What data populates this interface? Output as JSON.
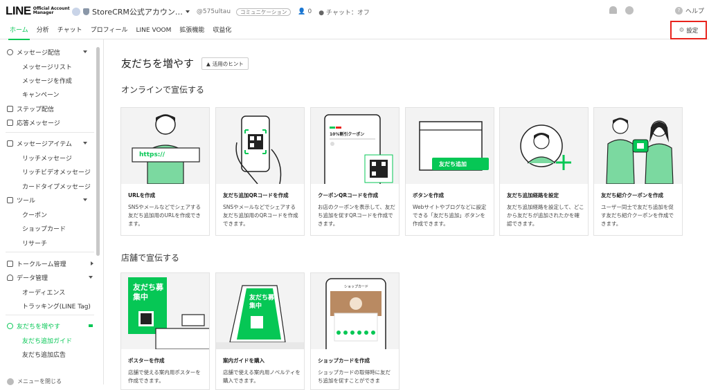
{
  "header": {
    "logo_main": "LINE",
    "logo_sub1": "Official Account",
    "logo_sub2": "Manager",
    "account_name": "StoreCRM公式アカウン…",
    "account_id": "@575ultau",
    "plan": "コミュニケーション",
    "friends_count": "0",
    "chat_status": "チャット：オフ",
    "help": "ヘルプ"
  },
  "nav": {
    "tabs": [
      "ホーム",
      "分析",
      "チャット",
      "プロフィール",
      "LINE VOOM",
      "拡張機能",
      "収益化"
    ],
    "settings": "設定"
  },
  "sidebar": {
    "message": "メッセージ配信",
    "message_list": "メッセージリスト",
    "message_create": "メッセージを作成",
    "campaign": "キャンペーン",
    "step": "ステップ配信",
    "response": "応答メッセージ",
    "items": "メッセージアイテム",
    "rich": "リッチメッセージ",
    "rich_video": "リッチビデオメッセージ",
    "card_type": "カードタイプメッセージ",
    "tools": "ツール",
    "coupon": "クーポン",
    "shop_card": "ショップカード",
    "research": "リサーチ",
    "chatroom": "トークルーム管理",
    "data": "データ管理",
    "audience": "オーディエンス",
    "tracking": "トラッキング(LINE Tag)",
    "friends": "友だちを増やす",
    "friends_guide": "友だち追加ガイド",
    "friends_ad": "友だち追加広告",
    "collapse": "メニューを閉じる"
  },
  "main": {
    "title": "友だちを増やす",
    "hint": "活用のヒント",
    "online_section": "オンラインで宣伝する",
    "store_section": "店舗で宣伝する",
    "online_cards": [
      {
        "title": "URLを作成",
        "desc": "SNSやメールなどでシェアする友だち追加用のURLを作成できます。",
        "art": "https://"
      },
      {
        "title": "友だち追加QRコードを作成",
        "desc": "SNSやメールなどでシェアする友だち追加用のQRコードを作成できます。"
      },
      {
        "title": "クーポンQRコードを作成",
        "desc": "お店のクーポンを表示して、友だち追加を促すQRコードを作成できます。",
        "art": "10%割引クーポン"
      },
      {
        "title": "ボタンを作成",
        "desc": "Webサイトやブログなどに設定できる「友だち追加」ボタンを作成できます。",
        "art": "友だち追加"
      },
      {
        "title": "友だち追加経路を設定",
        "desc": "友だち追加経路を設定して、どこから友だちが追加されたかを確認できます。"
      },
      {
        "title": "友だち紹介クーポンを作成",
        "desc": "ユーザー同士で友だち追加を促す友だち紹介クーポンを作成できます。"
      }
    ],
    "store_cards": [
      {
        "title": "ポスターを作成",
        "desc": "店舗で使える案内用ポスターを作成できます。",
        "art": "友だち募集中"
      },
      {
        "title": "案内ガイドを購入",
        "desc": "店舗で使える案内用ノベルティを購入できます。",
        "art": "友だち募集中"
      },
      {
        "title": "ショップカードを作成",
        "desc": "ショップカードの取得時に友だち追加を促すことができま",
        "art": "ショップカード"
      }
    ]
  },
  "colors": {
    "brand": "#06c755",
    "highlight": "#e8221c"
  }
}
